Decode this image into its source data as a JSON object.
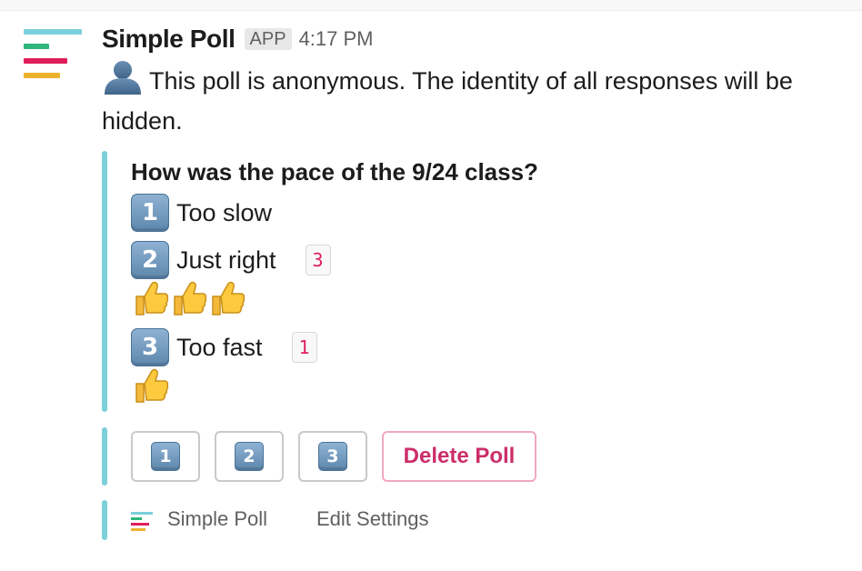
{
  "message": {
    "sender": "Simple Poll",
    "app_badge": "APP",
    "timestamp": "4:17 PM",
    "anonymous_notice": "This poll is anonymous. The identity of all responses will be hidden.",
    "avatar_colors": [
      "#7ccfdb",
      "#2eb67d",
      "#e01e5a",
      "#ecb22e"
    ]
  },
  "poll": {
    "question": "How was the pace of the 9/24 class?",
    "accent_color": "#7ccfdb",
    "options": [
      {
        "number": "1",
        "label": "Too slow",
        "count": "",
        "votes": 0
      },
      {
        "number": "2",
        "label": "Just right",
        "count": "3",
        "votes": 3
      },
      {
        "number": "3",
        "label": "Too fast",
        "count": "1",
        "votes": 1
      }
    ]
  },
  "actions": {
    "vote_buttons": [
      "1",
      "2",
      "3"
    ],
    "delete_label": "Delete Poll"
  },
  "footer": {
    "app_name": "Simple Poll",
    "edit_settings": "Edit Settings"
  }
}
